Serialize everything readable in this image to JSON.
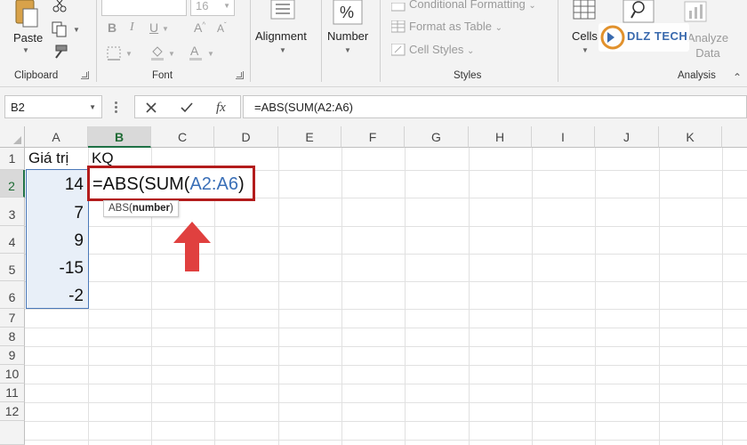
{
  "ribbon": {
    "clipboard": {
      "paste_label": "Paste",
      "group_label": "Clipboard"
    },
    "font": {
      "font_size": "16",
      "group_label": "Font"
    },
    "alignment": {
      "label": "Alignment"
    },
    "number": {
      "label": "Number"
    },
    "styles": {
      "conditional_formatting": "Conditional Formatting",
      "format_as_table": "Format as Table",
      "cell_styles": "Cell Styles",
      "group_label": "Styles"
    },
    "cells": {
      "label": "Cells"
    },
    "analysis": {
      "analyze_label": "Analyze",
      "data_label": "Data",
      "group_label": "Analysis"
    },
    "logo_text": "DLZ TECH"
  },
  "formula_bar": {
    "name_box": "B2",
    "formula": "=ABS(SUM(A2:A6)"
  },
  "grid": {
    "columns": [
      "A",
      "B",
      "C",
      "D",
      "E",
      "F",
      "G",
      "H",
      "I",
      "J",
      "K"
    ],
    "rows": [
      "1",
      "2",
      "3",
      "4",
      "5",
      "6",
      "7",
      "8",
      "9",
      "10",
      "11",
      "12"
    ],
    "a1": "Giá trị",
    "b1": "KQ",
    "a_values": [
      "14",
      "7",
      "9",
      "-15",
      "-2"
    ],
    "edit": {
      "prefix": "=ABS(SUM(",
      "ref": "A2:A6",
      "suffix": ")"
    },
    "tooltip": {
      "fn": "ABS(",
      "arg": "number",
      "close": ")"
    }
  },
  "colors": {
    "highlight_box": "#b31c1c",
    "arrow": "#e0403f",
    "ref_blue": "#3a6fb7",
    "excel_green": "#1e7145"
  }
}
